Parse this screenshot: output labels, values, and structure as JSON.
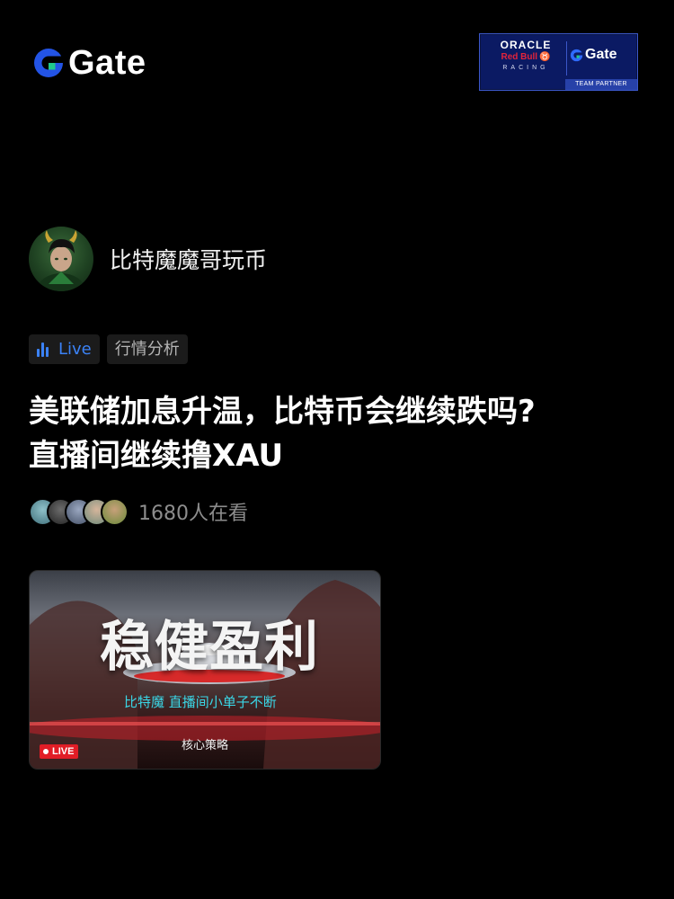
{
  "brand": {
    "name": "Gate",
    "accent": "#2354e6"
  },
  "partner": {
    "oracle": "ORACLE",
    "redbull": "Red Bull",
    "racing": "RACING",
    "gate": "Gate",
    "team_partner": "TEAM PARTNER"
  },
  "author": {
    "name": "比特魔魔哥玩币"
  },
  "tags": {
    "live": "Live",
    "category": "行情分析"
  },
  "title": {
    "line1": "美联储加息升温，比特币会继续跌吗?",
    "line2": "直播间继续撸XAU"
  },
  "viewers": {
    "count_text": "1680人在看"
  },
  "thumbnail": {
    "headline": "稳健盈利",
    "subtitle": "比特魔  直播间小单子不断",
    "caption": "核心策略",
    "live_badge": "LIVE"
  },
  "colors": {
    "live_blue": "#3b82f6",
    "live_red": "#e11d26",
    "subtitle_cyan": "#3ad6e6"
  }
}
